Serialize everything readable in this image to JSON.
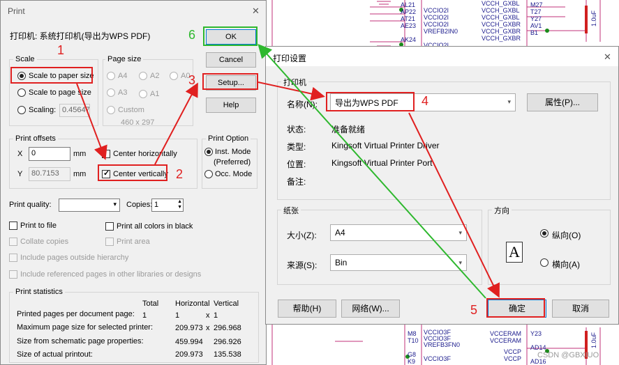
{
  "schematic": {
    "labels": [
      "AL21",
      "AP22",
      "AT21",
      "AE23",
      "AK24",
      "VCCIO2I",
      "VCCIO2I",
      "VCCIO2I",
      "VREFB2IN0",
      "VCCIO2I",
      "VCCH_GXBL",
      "VCCH_GXBL",
      "VCCH_GXBL",
      "VCCH_GXBR",
      "VCCH_GXBR",
      "VCCH_GXBR",
      "M27",
      "T27",
      "Y27",
      "AV1",
      "B1",
      "M8",
      "T10",
      "VCCIO3F",
      "VCCIO3F",
      "VREFB3FN0",
      "VCCERAM",
      "VCCERAM",
      "VCCP",
      "VCCP",
      "VCCIO3F",
      "G8",
      "K9",
      "Y23",
      "AD14",
      "AD16",
      "1.0uF",
      "1.0uF",
      "CSDN @GBXIUO"
    ]
  },
  "print_dialog": {
    "title": "Print",
    "printer_label": "打印机: 系统打印机(导出为WPS PDF)",
    "scale": {
      "group": "Scale",
      "opt1": "Scale to paper size",
      "opt2": "Scale to page size",
      "opt3": "Scaling:",
      "scaling_value": "0.45647"
    },
    "page_size": {
      "group": "Page size",
      "a4": "A4",
      "a2": "A2",
      "a0": "A0",
      "a3": "A3",
      "a1": "A1",
      "custom": "Custom",
      "custom_size": "460 x 297"
    },
    "buttons": {
      "ok": "OK",
      "cancel": "Cancel",
      "setup": "Setup...",
      "help": "Help"
    },
    "offsets": {
      "group": "Print offsets",
      "x_label": "X",
      "x_value": "0",
      "y_label": "Y",
      "y_value": "80.7153",
      "unit": "mm",
      "center_h": "Center horizontally",
      "center_v": "Center vertically"
    },
    "option": {
      "group": "Print Option",
      "inst": "Inst. Mode",
      "preferred": "(Preferred)",
      "occ": "Occ. Mode"
    },
    "quality_label": "Print quality:",
    "copies_label": "Copies:",
    "copies_value": "1",
    "checks": {
      "print_to_file": "Print to file",
      "all_black": "Print all colors in black",
      "collate": "Collate copies",
      "print_area": "Print area",
      "outside_hier": "Include pages outside hierarchy",
      "ref_libs": "Include referenced pages in other libraries or designs"
    },
    "stats": {
      "group": "Print statistics",
      "headers": [
        "Total",
        "Horizontal",
        "Vertical"
      ],
      "rows": [
        {
          "label": "Printed pages per document page:",
          "total": "1",
          "h": "1",
          "x": "x",
          "v": "1"
        },
        {
          "label": "Maximum page size for selected printer:",
          "h": "209.973",
          "x": "x",
          "v": "296.968"
        },
        {
          "label": "Size from schematic page properties:",
          "h": "459.994",
          "v": "296.926"
        },
        {
          "label": "Size of actual printout:",
          "h": "209.973",
          "v": "135.538"
        }
      ]
    }
  },
  "setup_dialog": {
    "title": "打印设置",
    "printer_group": "打印机",
    "name_label": "名称(N):",
    "name_value": "导出为WPS PDF",
    "props_button": "属性(P)...",
    "status_label": "状态:",
    "status_value": "准备就绪",
    "type_label": "类型:",
    "type_value": "Kingsoft Virtual Printer Driver",
    "where_label": "位置:",
    "where_value": "Kingsoft Virtual Printer Port",
    "comment_label": "备注:",
    "paper_group": "纸张",
    "size_label": "大小(Z):",
    "size_value": "A4",
    "source_label": "来源(S):",
    "source_value": "Bin",
    "orient_group": "方向",
    "portrait": "纵向(O)",
    "landscape": "横向(A)",
    "orient_glyph": "A",
    "help_button": "帮助(H)",
    "network_button": "网络(W)...",
    "ok_button": "确定",
    "cancel_button": "取消"
  },
  "steps": [
    "1",
    "2",
    "3",
    "4",
    "5",
    "6"
  ],
  "colors": {
    "red": "#e02020",
    "green": "#2eb82e"
  }
}
